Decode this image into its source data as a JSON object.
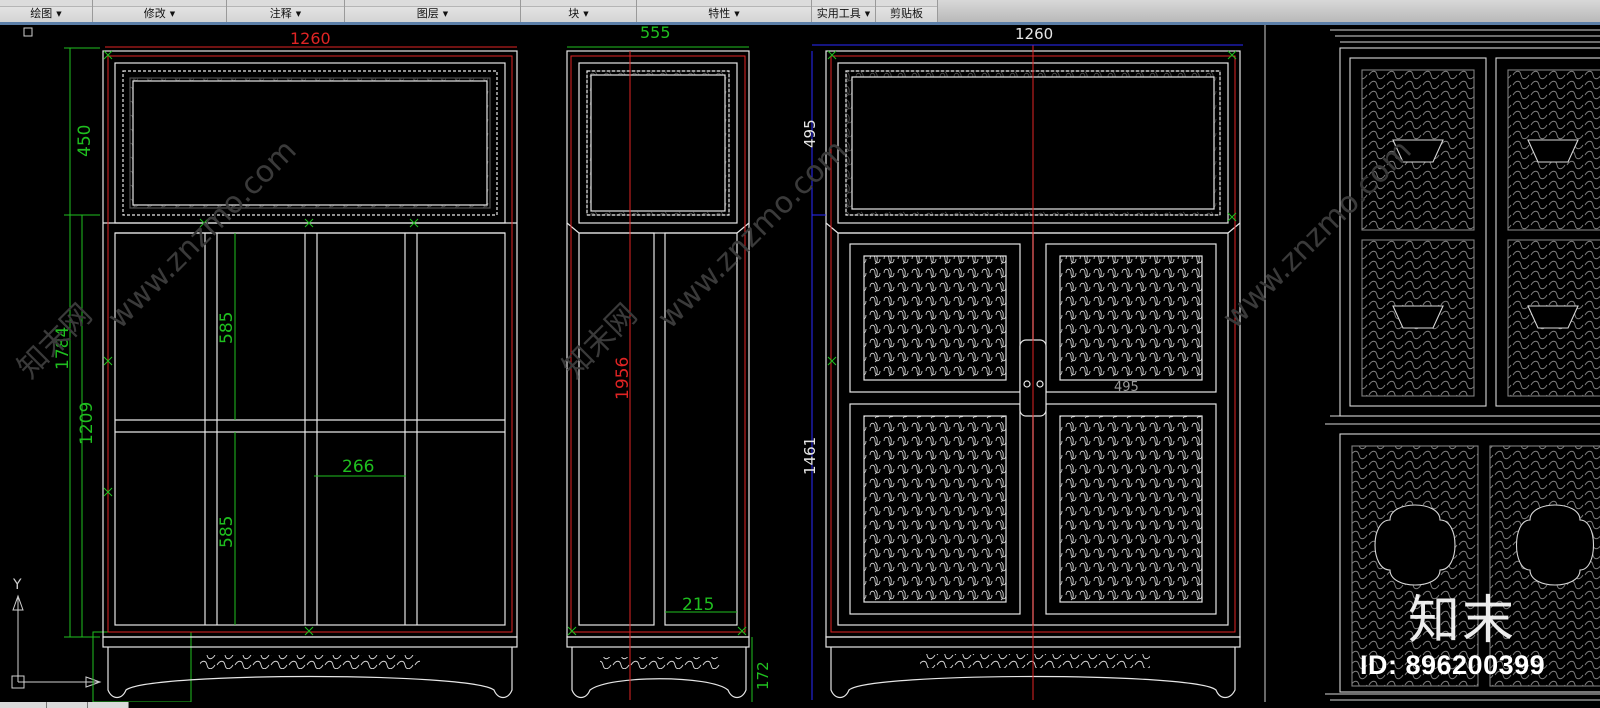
{
  "ribbon": {
    "panels": [
      {
        "label": "绘图"
      },
      {
        "label": "修改"
      },
      {
        "label": "注释"
      },
      {
        "label": "图层"
      },
      {
        "label": "块"
      },
      {
        "label": "特性"
      },
      {
        "label": "实用工具"
      },
      {
        "label": "剪贴板"
      }
    ]
  },
  "drawing": {
    "front": {
      "width": "1260",
      "top_height": "450",
      "total": "1784",
      "body": "1209",
      "shelf_upper": "585",
      "shelf_lower": "585",
      "spacing": "266"
    },
    "side": {
      "width": "555",
      "height": "1956",
      "depth": "215",
      "base": "172"
    },
    "doors": {
      "width": "1260",
      "top": "495",
      "body": "1461",
      "panel": "495"
    }
  },
  "ucs": {
    "y_label": "Y"
  },
  "watermark": {
    "site": "www.znzmo.com",
    "brand": "知末网",
    "logo": "知末",
    "id": "ID: 896200399"
  },
  "colors": {
    "background": "#000000",
    "outline": "#e6e6e6",
    "dim_green": "#1fbf1f",
    "dim_red": "#e02424",
    "dim_blue": "#2a2aff"
  }
}
